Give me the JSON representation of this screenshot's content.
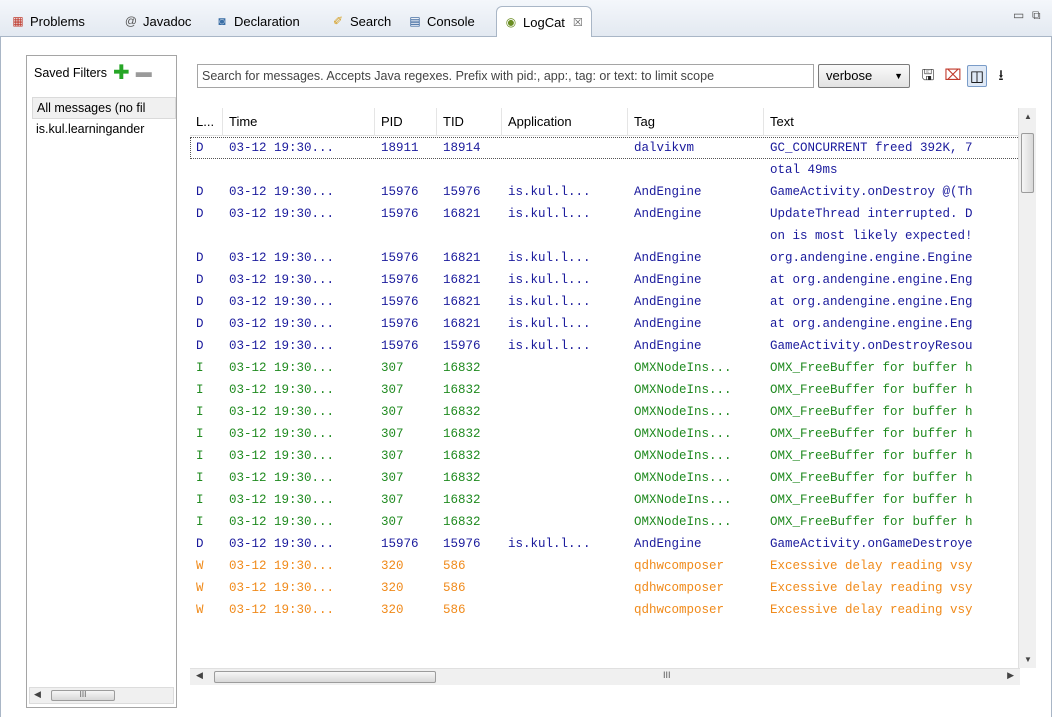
{
  "tabs": [
    {
      "label": "Problems",
      "icon": "problems-icon",
      "glyph": "▦"
    },
    {
      "label": "Javadoc",
      "icon": "at-icon",
      "glyph": "@"
    },
    {
      "label": "Declaration",
      "icon": "declaration-icon",
      "glyph": "◙"
    },
    {
      "label": "Search",
      "icon": "search-icon",
      "glyph": "✐"
    },
    {
      "label": "Console",
      "icon": "console-icon",
      "glyph": "▤"
    },
    {
      "label": "LogCat",
      "icon": "logcat-icon",
      "glyph": "◉",
      "active": true,
      "close": "☒"
    }
  ],
  "window_controls": {
    "minimize": "▭",
    "maximize": "⧉"
  },
  "saved_filters": {
    "title": "Saved Filters",
    "add": "✚",
    "remove": "▬",
    "items": [
      "All messages (no fil",
      "is.kul.learningander"
    ]
  },
  "search": {
    "placeholder": "Search for messages. Accepts Java regexes. Prefix with pid:, app:, tag: or text: to limit scope"
  },
  "level_select": {
    "value": "verbose",
    "caret": "▼"
  },
  "toolbar": {
    "save": "🖫",
    "clear": "⌧",
    "toggle": "◫",
    "scroll_lock": "⭳"
  },
  "columns": [
    "L...",
    "Time",
    "PID",
    "TID",
    "Application",
    "Tag",
    "Text"
  ],
  "rows": [
    {
      "level": "D",
      "time": "03-12 19:30...",
      "pid": "18911",
      "tid": "18914",
      "app": "",
      "tag": "dalvikvm",
      "text": "GC_CONCURRENT freed 392K, 7",
      "selected": true
    },
    {
      "level": "",
      "time": "",
      "pid": "",
      "tid": "",
      "app": "",
      "tag": "",
      "text": "otal 49ms",
      "cont": true
    },
    {
      "level": "D",
      "time": "03-12 19:30...",
      "pid": "15976",
      "tid": "15976",
      "app": "is.kul.l...",
      "tag": "AndEngine",
      "text": "GameActivity.onDestroy @(Th"
    },
    {
      "level": "D",
      "time": "03-12 19:30...",
      "pid": "15976",
      "tid": "16821",
      "app": "is.kul.l...",
      "tag": "AndEngine",
      "text": "UpdateThread interrupted. D"
    },
    {
      "level": "",
      "time": "",
      "pid": "",
      "tid": "",
      "app": "",
      "tag": "",
      "text": "on is most likely expected!",
      "cont": true
    },
    {
      "level": "D",
      "time": "03-12 19:30...",
      "pid": "15976",
      "tid": "16821",
      "app": "is.kul.l...",
      "tag": "AndEngine",
      "text": "org.andengine.engine.Engine"
    },
    {
      "level": "D",
      "time": "03-12 19:30...",
      "pid": "15976",
      "tid": "16821",
      "app": "is.kul.l...",
      "tag": "AndEngine",
      "text": "at org.andengine.engine.Eng"
    },
    {
      "level": "D",
      "time": "03-12 19:30...",
      "pid": "15976",
      "tid": "16821",
      "app": "is.kul.l...",
      "tag": "AndEngine",
      "text": "at org.andengine.engine.Eng"
    },
    {
      "level": "D",
      "time": "03-12 19:30...",
      "pid": "15976",
      "tid": "16821",
      "app": "is.kul.l...",
      "tag": "AndEngine",
      "text": "at org.andengine.engine.Eng"
    },
    {
      "level": "D",
      "time": "03-12 19:30...",
      "pid": "15976",
      "tid": "15976",
      "app": "is.kul.l...",
      "tag": "AndEngine",
      "text": "GameActivity.onDestroyResou"
    },
    {
      "level": "I",
      "time": "03-12 19:30...",
      "pid": "307",
      "tid": "16832",
      "app": "",
      "tag": "OMXNodeIns...",
      "text": "OMX_FreeBuffer for buffer h"
    },
    {
      "level": "I",
      "time": "03-12 19:30...",
      "pid": "307",
      "tid": "16832",
      "app": "",
      "tag": "OMXNodeIns...",
      "text": "OMX_FreeBuffer for buffer h"
    },
    {
      "level": "I",
      "time": "03-12 19:30...",
      "pid": "307",
      "tid": "16832",
      "app": "",
      "tag": "OMXNodeIns...",
      "text": "OMX_FreeBuffer for buffer h"
    },
    {
      "level": "I",
      "time": "03-12 19:30...",
      "pid": "307",
      "tid": "16832",
      "app": "",
      "tag": "OMXNodeIns...",
      "text": "OMX_FreeBuffer for buffer h"
    },
    {
      "level": "I",
      "time": "03-12 19:30...",
      "pid": "307",
      "tid": "16832",
      "app": "",
      "tag": "OMXNodeIns...",
      "text": "OMX_FreeBuffer for buffer h"
    },
    {
      "level": "I",
      "time": "03-12 19:30...",
      "pid": "307",
      "tid": "16832",
      "app": "",
      "tag": "OMXNodeIns...",
      "text": "OMX_FreeBuffer for buffer h"
    },
    {
      "level": "I",
      "time": "03-12 19:30...",
      "pid": "307",
      "tid": "16832",
      "app": "",
      "tag": "OMXNodeIns...",
      "text": "OMX_FreeBuffer for buffer h"
    },
    {
      "level": "I",
      "time": "03-12 19:30...",
      "pid": "307",
      "tid": "16832",
      "app": "",
      "tag": "OMXNodeIns...",
      "text": "OMX_FreeBuffer for buffer h"
    },
    {
      "level": "D",
      "time": "03-12 19:30...",
      "pid": "15976",
      "tid": "15976",
      "app": "is.kul.l...",
      "tag": "AndEngine",
      "text": "GameActivity.onGameDestroye"
    },
    {
      "level": "W",
      "time": "03-12 19:30...",
      "pid": "320",
      "tid": "586",
      "app": "",
      "tag": "qdhwcomposer",
      "text": "Excessive delay reading vsy"
    },
    {
      "level": "W",
      "time": "03-12 19:30...",
      "pid": "320",
      "tid": "586",
      "app": "",
      "tag": "qdhwcomposer",
      "text": "Excessive delay reading vsy"
    },
    {
      "level": "W",
      "time": "03-12 19:30...",
      "pid": "320",
      "tid": "586",
      "app": "",
      "tag": "qdhwcomposer",
      "text": "Excessive delay reading vsy"
    }
  ],
  "level_colors": {
    "D": "#1a1a9c",
    "I": "#1f8a1f",
    "W": "#f08a1a"
  },
  "scroll_glyphs": {
    "up": "▲",
    "down": "▼",
    "left": "◀",
    "right": "▶",
    "grip": "III"
  }
}
